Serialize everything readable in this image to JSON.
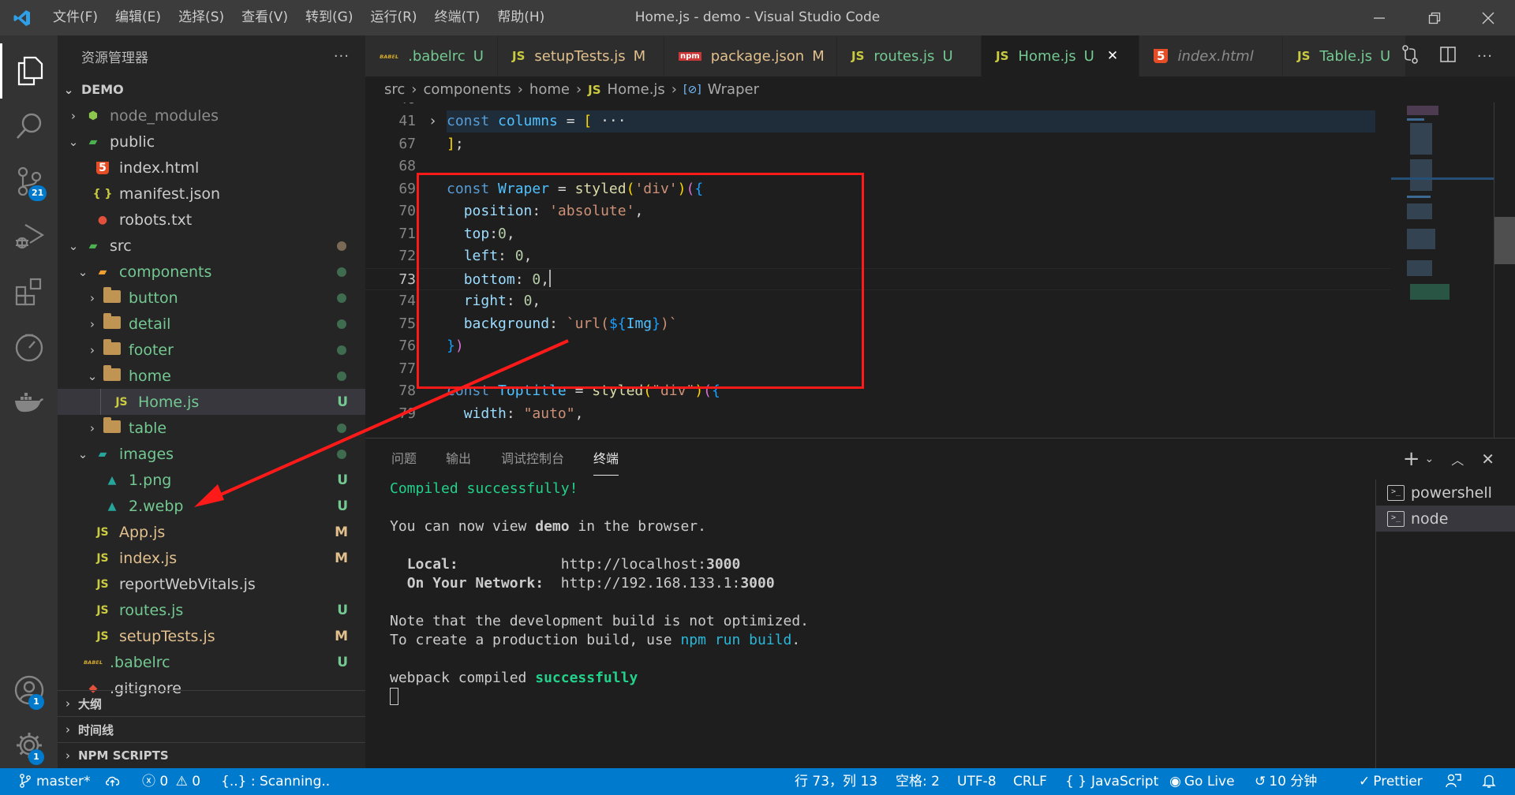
{
  "window": {
    "title": "Home.js - demo - Visual Studio Code",
    "menu": [
      "文件(F)",
      "编辑(E)",
      "选择(S)",
      "查看(V)",
      "转到(G)",
      "运行(R)",
      "终端(T)",
      "帮助(H)"
    ]
  },
  "activity_bar": {
    "items": [
      {
        "name": "explorer",
        "icon": "files-icon",
        "active": true
      },
      {
        "name": "search",
        "icon": "search-icon"
      },
      {
        "name": "source-control",
        "icon": "source-control-icon",
        "badge": "21"
      },
      {
        "name": "run-debug",
        "icon": "run-debug-icon"
      },
      {
        "name": "extensions",
        "icon": "extensions-icon"
      },
      {
        "name": "timeline",
        "icon": "clock-icon"
      },
      {
        "name": "docker",
        "icon": "docker-icon"
      }
    ],
    "bottom": [
      {
        "name": "accounts",
        "icon": "account-icon",
        "badge": "1"
      },
      {
        "name": "manage",
        "icon": "gear-icon",
        "badge": "1"
      }
    ]
  },
  "sidebar": {
    "title": "资源管理器",
    "more": "···",
    "root": "DEMO",
    "tree": [
      {
        "label": "node_modules",
        "depth": 1,
        "chevron": "right",
        "icon": "node-folder",
        "color": "ignored"
      },
      {
        "label": "public",
        "depth": 1,
        "chevron": "down",
        "icon": "public-folder",
        "color": "normal"
      },
      {
        "label": "index.html",
        "depth": 2,
        "icon": "html5",
        "color": "normal"
      },
      {
        "label": "manifest.json",
        "depth": 2,
        "icon": "json",
        "color": "normal"
      },
      {
        "label": "robots.txt",
        "depth": 2,
        "icon": "robot",
        "color": "normal"
      },
      {
        "label": "src",
        "depth": 1,
        "chevron": "down",
        "icon": "src-folder",
        "color": "normal",
        "dot": "#7a6a55"
      },
      {
        "label": "components",
        "depth": 2,
        "chevron": "down",
        "icon": "components-folder",
        "color": "green",
        "dot": "#3f6b4f"
      },
      {
        "label": "button",
        "depth": 3,
        "chevron": "right",
        "icon": "folder",
        "color": "green",
        "dot": "#3f6b4f"
      },
      {
        "label": "detail",
        "depth": 3,
        "chevron": "right",
        "icon": "folder",
        "color": "green",
        "dot": "#3f6b4f"
      },
      {
        "label": "footer",
        "depth": 3,
        "chevron": "right",
        "icon": "folder",
        "color": "green",
        "dot": "#3f6b4f"
      },
      {
        "label": "home",
        "depth": 3,
        "chevron": "down",
        "icon": "folder-open",
        "color": "green",
        "dot": "#3f6b4f"
      },
      {
        "label": "Home.js",
        "depth": 4,
        "icon": "js",
        "color": "green",
        "deco": "U",
        "selected": true
      },
      {
        "label": "table",
        "depth": 3,
        "chevron": "right",
        "icon": "folder",
        "color": "green",
        "dot": "#3f6b4f"
      },
      {
        "label": "images",
        "depth": 2,
        "chevron": "down",
        "icon": "images-folder",
        "color": "green",
        "dot": "#3f6b4f"
      },
      {
        "label": "1.png",
        "depth": 3,
        "icon": "image",
        "color": "green",
        "deco": "U"
      },
      {
        "label": "2.webp",
        "depth": 3,
        "icon": "image",
        "color": "green",
        "deco": "U"
      },
      {
        "label": "App.js",
        "depth": 2,
        "icon": "js",
        "color": "modified",
        "deco": "M"
      },
      {
        "label": "index.js",
        "depth": 2,
        "icon": "js",
        "color": "modified",
        "deco": "M"
      },
      {
        "label": "reportWebVitals.js",
        "depth": 2,
        "icon": "js",
        "color": "normal"
      },
      {
        "label": "routes.js",
        "depth": 2,
        "icon": "js",
        "color": "green",
        "deco": "U"
      },
      {
        "label": "setupTests.js",
        "depth": 2,
        "icon": "js",
        "color": "modified",
        "deco": "M"
      },
      {
        "label": ".babelrc",
        "depth": 1,
        "icon": "babel",
        "color": "green",
        "deco": "U"
      },
      {
        "label": ".gitignore",
        "depth": 1,
        "icon": "git",
        "color": "normal"
      }
    ],
    "sections": [
      "大纲",
      "时间线",
      "NPM SCRIPTS"
    ]
  },
  "tabs": [
    {
      "label": ".babelrc",
      "icon": "babel",
      "deco": "U",
      "color": "green"
    },
    {
      "label": "setupTests.js",
      "icon": "js",
      "deco": "M",
      "color": "modified"
    },
    {
      "label": "package.json",
      "icon": "npm",
      "deco": "M",
      "color": "modified"
    },
    {
      "label": "routes.js",
      "icon": "js",
      "deco": "U",
      "color": "green"
    },
    {
      "label": "Home.js",
      "icon": "js",
      "deco": "U",
      "color": "green",
      "active": true
    },
    {
      "label": "index.html",
      "icon": "html5",
      "italic": true,
      "color": "ignored"
    },
    {
      "label": "Table.js",
      "icon": "js",
      "deco": "U",
      "color": "green"
    }
  ],
  "tab_actions": [
    "compare-changes-icon",
    "split-editor-icon",
    "more-icon"
  ],
  "breadcrumb": [
    "src",
    "components",
    "home",
    "Home.js",
    "Wraper"
  ],
  "editor": {
    "cursor_line": 73,
    "lines": [
      {
        "no": "41",
        "folded": true,
        "tokens": [
          [
            "k",
            "const "
          ],
          [
            "v",
            "columns"
          ],
          [
            "t",
            " = "
          ],
          [
            "b1",
            "["
          ],
          [
            "t",
            " ···"
          ]
        ]
      },
      {
        "no": "67",
        "tokens": [
          [
            "b1",
            "]"
          ],
          [
            "t",
            ";"
          ]
        ]
      },
      {
        "no": "68",
        "tokens": []
      },
      {
        "no": "69",
        "tokens": [
          [
            "k",
            "const "
          ],
          [
            "v",
            "Wraper"
          ],
          [
            "t",
            " = "
          ],
          [
            "f",
            "styled"
          ],
          [
            "b1",
            "("
          ],
          [
            "s",
            "'div'"
          ],
          [
            "b1",
            ")"
          ],
          [
            "b2",
            "("
          ],
          [
            "b3",
            "{"
          ]
        ]
      },
      {
        "no": "70",
        "tokens": [
          [
            "t",
            "  "
          ],
          [
            "p",
            "position"
          ],
          [
            "t",
            ": "
          ],
          [
            "s",
            "'absolute'"
          ],
          [
            "t",
            ","
          ]
        ]
      },
      {
        "no": "71",
        "tokens": [
          [
            "t",
            "  "
          ],
          [
            "p",
            "top"
          ],
          [
            "t",
            ":"
          ],
          [
            "n",
            "0"
          ],
          [
            "t",
            ","
          ]
        ]
      },
      {
        "no": "72",
        "tokens": [
          [
            "t",
            "  "
          ],
          [
            "p",
            "left"
          ],
          [
            "t",
            ": "
          ],
          [
            "n",
            "0"
          ],
          [
            "t",
            ","
          ]
        ]
      },
      {
        "no": "73",
        "tokens": [
          [
            "t",
            "  "
          ],
          [
            "p",
            "bottom"
          ],
          [
            "t",
            ": "
          ],
          [
            "n",
            "0"
          ],
          [
            "t",
            ","
          ]
        ]
      },
      {
        "no": "74",
        "tokens": [
          [
            "t",
            "  "
          ],
          [
            "p",
            "right"
          ],
          [
            "t",
            ": "
          ],
          [
            "n",
            "0"
          ],
          [
            "t",
            ","
          ]
        ]
      },
      {
        "no": "75",
        "tokens": [
          [
            "t",
            "  "
          ],
          [
            "p",
            "background"
          ],
          [
            "t",
            ": "
          ],
          [
            "s",
            "`url("
          ],
          [
            "b3",
            "${"
          ],
          [
            "v",
            "Img"
          ],
          [
            "b3",
            "}"
          ],
          [
            "s",
            ")`"
          ]
        ]
      },
      {
        "no": "76",
        "tokens": [
          [
            "b3",
            "}"
          ],
          [
            "b2",
            ")"
          ]
        ]
      },
      {
        "no": "77",
        "tokens": []
      },
      {
        "no": "78",
        "tokens": [
          [
            "k",
            "const "
          ],
          [
            "v",
            "Toptitle"
          ],
          [
            "t",
            " = "
          ],
          [
            "f",
            "styled"
          ],
          [
            "b1",
            "("
          ],
          [
            "s",
            "\"div\""
          ],
          [
            "b1",
            ")"
          ],
          [
            "b2",
            "("
          ],
          [
            "b3",
            "{"
          ]
        ]
      },
      {
        "no": "79",
        "tokens": [
          [
            "t",
            "  "
          ],
          [
            "p",
            "width"
          ],
          [
            "t",
            ": "
          ],
          [
            "s",
            "\"auto\""
          ],
          [
            "t",
            ","
          ]
        ]
      }
    ]
  },
  "panel": {
    "tabs": [
      "问题",
      "输出",
      "调试控制台",
      "终端"
    ],
    "active_tab": "终端",
    "actions": [
      "new-terminal-icon",
      "chevron-down-icon",
      "maximize-icon",
      "close-icon"
    ],
    "terminal_lines": [
      [
        [
          "tgreen",
          "Compiled successfully!"
        ]
      ],
      [],
      [
        [
          "t",
          "You can now view "
        ],
        [
          "b",
          "demo"
        ],
        [
          "t",
          " in the browser."
        ]
      ],
      [],
      [
        [
          "t",
          "  "
        ],
        [
          "b",
          "Local:"
        ],
        [
          "t",
          "            http://localhost:"
        ],
        [
          "b",
          "3000"
        ]
      ],
      [
        [
          "t",
          "  "
        ],
        [
          "b",
          "On Your Network:"
        ],
        [
          "t",
          "  http://192.168.133.1:"
        ],
        [
          "b",
          "3000"
        ]
      ],
      [],
      [
        [
          "t",
          "Note that the development build is not optimized."
        ]
      ],
      [
        [
          "t",
          "To create a production build, use "
        ],
        [
          "tblue",
          "npm run build"
        ],
        [
          "t",
          "."
        ]
      ],
      [],
      [
        [
          "t",
          "webpack compiled "
        ],
        [
          "tgreenb",
          "successfully"
        ]
      ]
    ],
    "terminals": [
      {
        "label": "powershell"
      },
      {
        "label": "node",
        "active": true
      }
    ]
  },
  "statusbar": {
    "branch": "master*",
    "errors": "0",
    "warnings": "0",
    "scanning": "{..} : Scanning..",
    "position": "行 73，列 13",
    "spaces": "空格: 2",
    "encoding": "UTF-8",
    "eol": "CRLF",
    "language": "JavaScript",
    "language_icon": "{ }",
    "golive": "Go Live",
    "time": "10 分钟",
    "prettier": "Prettier"
  },
  "colors": {
    "statusbar": "#007acc",
    "annotation": "#ff1a1a",
    "git_untracked": "#73c991",
    "git_modified": "#e2c08d"
  }
}
